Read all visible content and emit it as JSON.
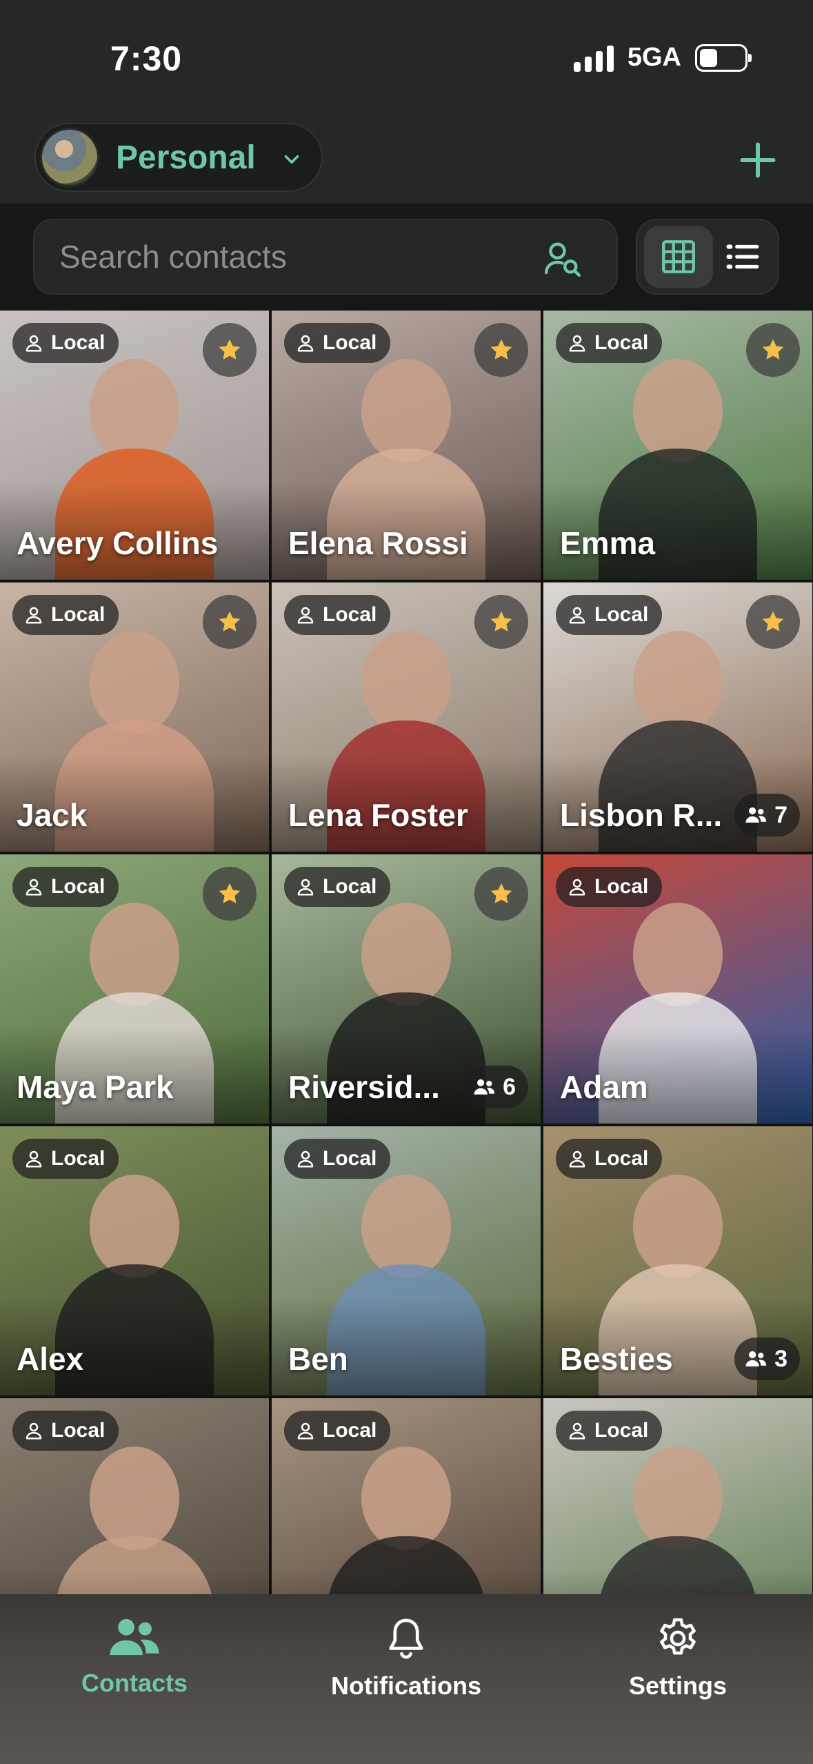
{
  "status_bar": {
    "time": "7:30",
    "network": "5GA"
  },
  "header": {
    "account_name": "Personal"
  },
  "search": {
    "placeholder": "Search contacts"
  },
  "contacts": [
    {
      "name": "Avery Collins",
      "badge": "Local",
      "favorite": true,
      "bg": [
        "#c9c4c2",
        "#9d938f"
      ],
      "accent": "#e05a1b"
    },
    {
      "name": "Elena Rossi",
      "badge": "Local",
      "favorite": true,
      "bg": [
        "#b8a9a3",
        "#6c5a52"
      ],
      "accent": "#d7b19a"
    },
    {
      "name": "Emma",
      "badge": "Local",
      "favorite": true,
      "bg": [
        "#a9b8a5",
        "#4e7a43"
      ],
      "accent": "#1f2420"
    },
    {
      "name": "Jack",
      "badge": "Local",
      "favorite": true,
      "bg": [
        "#c7b4a5",
        "#7e6758"
      ],
      "accent": "#d39f86"
    },
    {
      "name": "Lena Foster",
      "badge": "Local",
      "favorite": true,
      "bg": [
        "#c9c1b8",
        "#8c7a6b"
      ],
      "accent": "#a12a2a"
    },
    {
      "name": "Lisbon R...",
      "badge": "Local",
      "favorite": true,
      "count": "7",
      "bg": [
        "#dcdad6",
        "#8a6a54"
      ],
      "accent": "#2c2c2c"
    },
    {
      "name": "Maya Park",
      "badge": "Local",
      "favorite": true,
      "bg": [
        "#8ea77a",
        "#4f6b3b"
      ],
      "accent": "#e6dcd7"
    },
    {
      "name": "Riversid...",
      "badge": "Local",
      "favorite": true,
      "count": "6",
      "bg": [
        "#a8b79c",
        "#3f5234"
      ],
      "accent": "#1b1b1b"
    },
    {
      "name": "Adam",
      "badge": "Local",
      "favorite": false,
      "bg": [
        "#c5483a",
        "#2f5fa8"
      ],
      "accent": "#ececec"
    },
    {
      "name": "Alex",
      "badge": "Local",
      "favorite": false,
      "bg": [
        "#7e8e5a",
        "#465331"
      ],
      "accent": "#1e1e1e"
    },
    {
      "name": "Ben",
      "badge": "Local",
      "favorite": false,
      "bg": [
        "#a5b3a9",
        "#5b6a3e"
      ],
      "accent": "#6e8fb5"
    },
    {
      "name": "Besties",
      "badge": "Local",
      "favorite": false,
      "count": "3",
      "bg": [
        "#a8916f",
        "#57643a"
      ],
      "accent": "#e4c8b5"
    },
    {
      "name": "",
      "badge": "Local",
      "favorite": false,
      "bg": [
        "#8a7f72",
        "#4c4239"
      ],
      "accent": "#c9a38a"
    },
    {
      "name": "",
      "badge": "Local",
      "favorite": false,
      "bg": [
        "#a89582",
        "#4d3e33"
      ],
      "accent": "#1e1e1e"
    },
    {
      "name": "",
      "badge": "Local",
      "favorite": false,
      "bg": [
        "#c9c7c0",
        "#5c7a4e"
      ],
      "accent": "#2a2a2a"
    }
  ],
  "tabs": [
    {
      "label": "Contacts",
      "icon": "contacts-icon",
      "active": true
    },
    {
      "label": "Notifications",
      "icon": "bell-icon",
      "active": false
    },
    {
      "label": "Settings",
      "icon": "gear-icon",
      "active": false
    }
  ],
  "colors": {
    "accent": "#6fc7a8",
    "star": "#f5c04a"
  }
}
